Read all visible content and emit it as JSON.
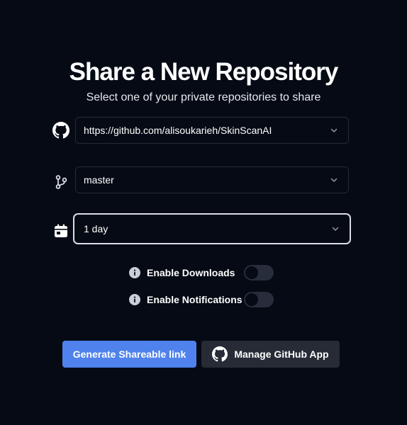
{
  "header": {
    "title": "Share a New Repository",
    "subtitle": "Select one of your private repositories to share"
  },
  "form": {
    "repository": {
      "icon": "github-icon",
      "value": "https://github.com/alisoukarieh/SkinScanAI"
    },
    "branch": {
      "icon": "git-branch-icon",
      "value": "master"
    },
    "expiration": {
      "icon": "calendar-icon",
      "value": "1 day"
    }
  },
  "toggles": {
    "downloads": {
      "label": "Enable Downloads",
      "enabled": false
    },
    "notifications": {
      "label": "Enable Notifications",
      "enabled": false
    }
  },
  "actions": {
    "generate_label": "Generate Shareable link",
    "manage_label": "Manage GitHub App"
  },
  "colors": {
    "background": "#050a14",
    "primary": "#4f82ec",
    "secondary": "#262b36",
    "border": "#262b38"
  }
}
